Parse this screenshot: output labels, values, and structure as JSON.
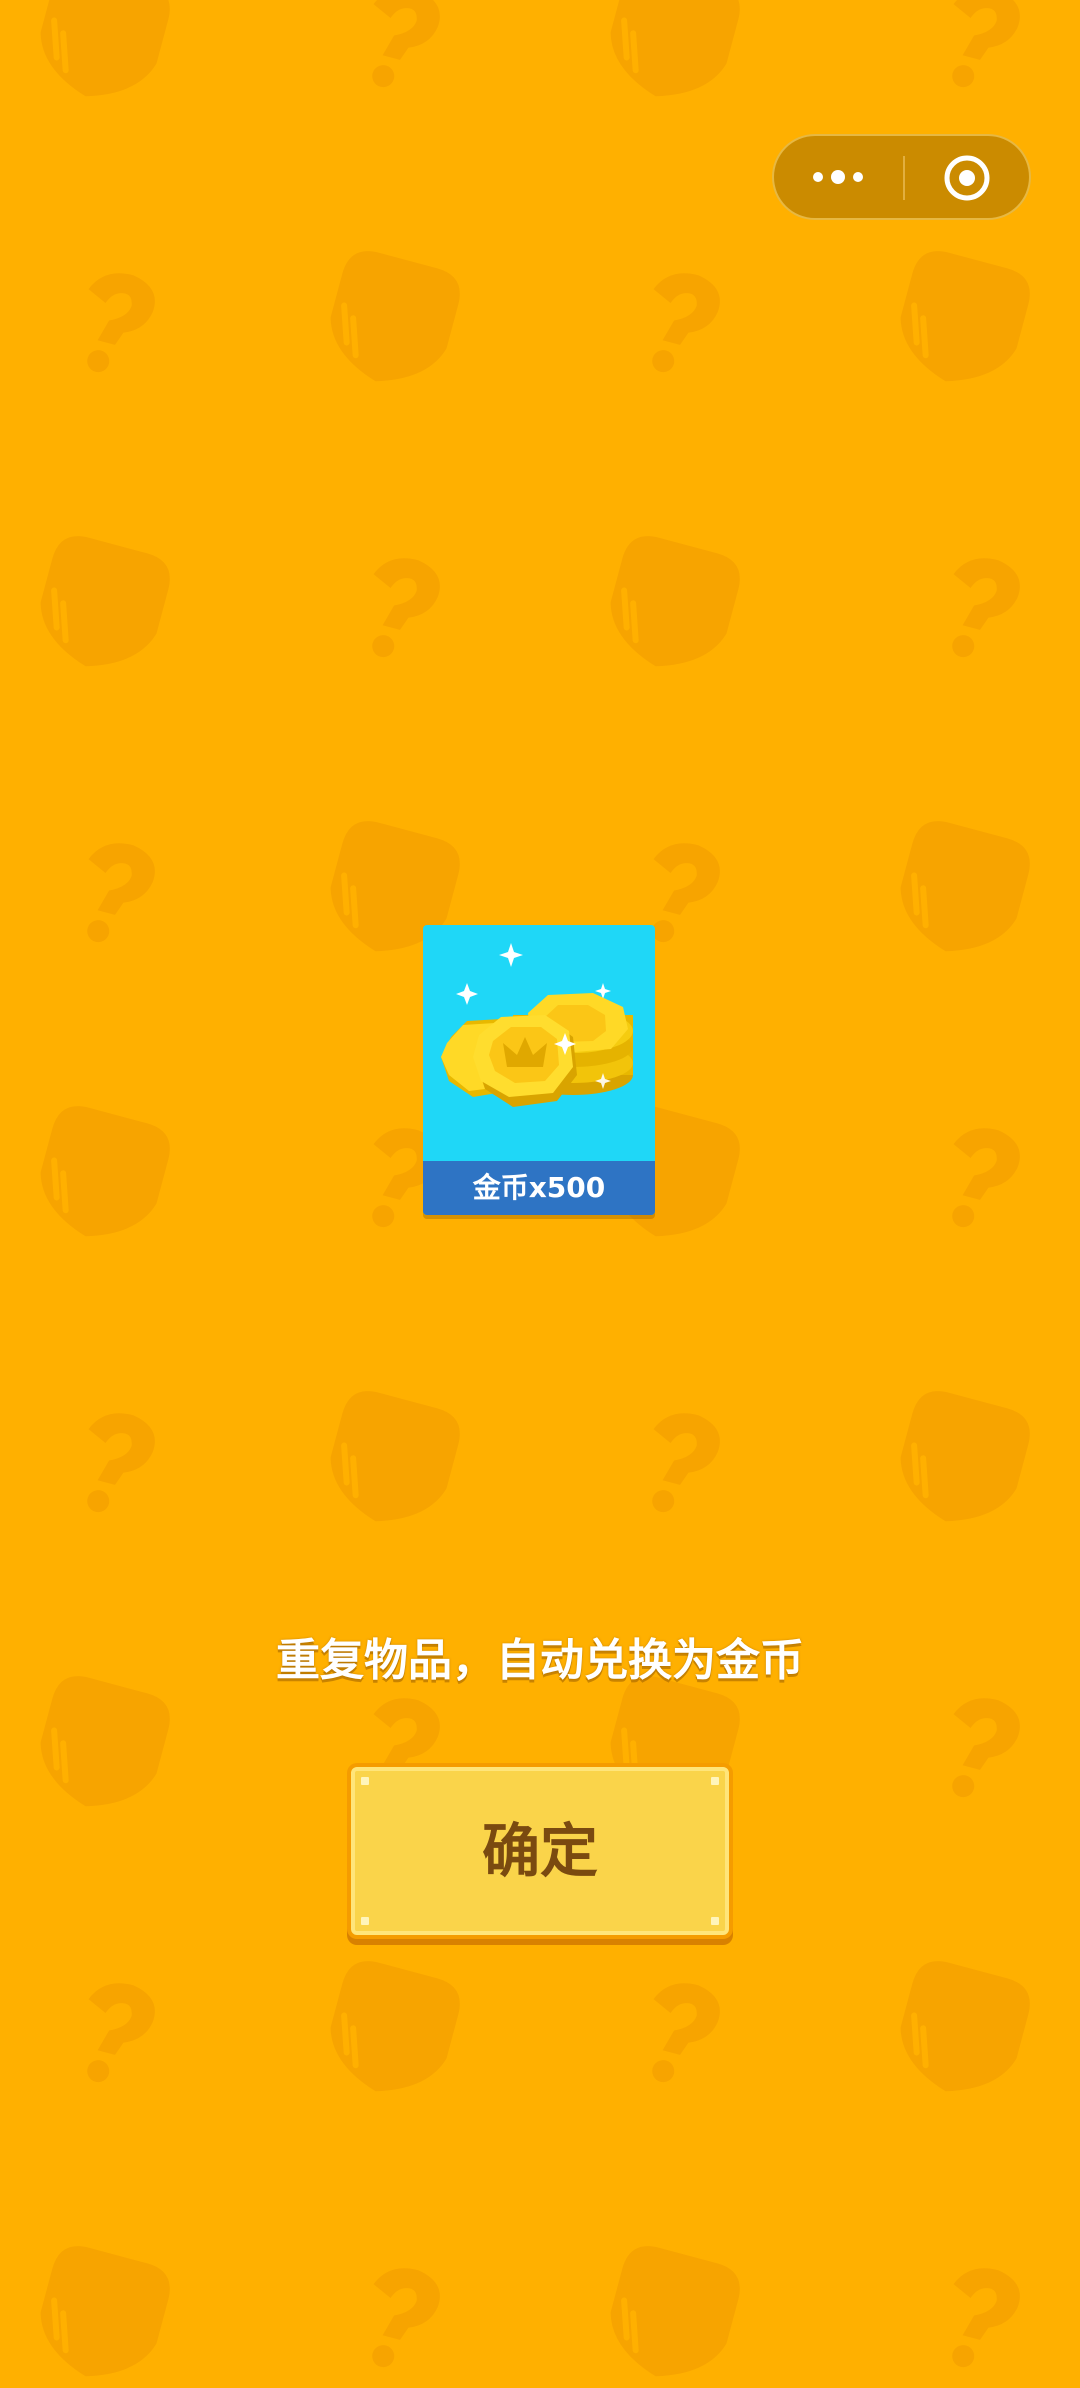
{
  "capsule": {
    "more_icon": "more-dots-icon",
    "close_icon": "target-circle-icon"
  },
  "reward": {
    "icon": "gold-coins-icon",
    "label": "金币x500"
  },
  "message": "重复物品，自动兑换为金币",
  "confirm_label": "确定",
  "colors": {
    "background": "#FFB000",
    "pattern": "#F7A400",
    "card_bg": "#1FD7F7",
    "card_label_bg": "#2E74C4",
    "button_bg": "#FAD44A",
    "button_text": "#7A4A10"
  }
}
